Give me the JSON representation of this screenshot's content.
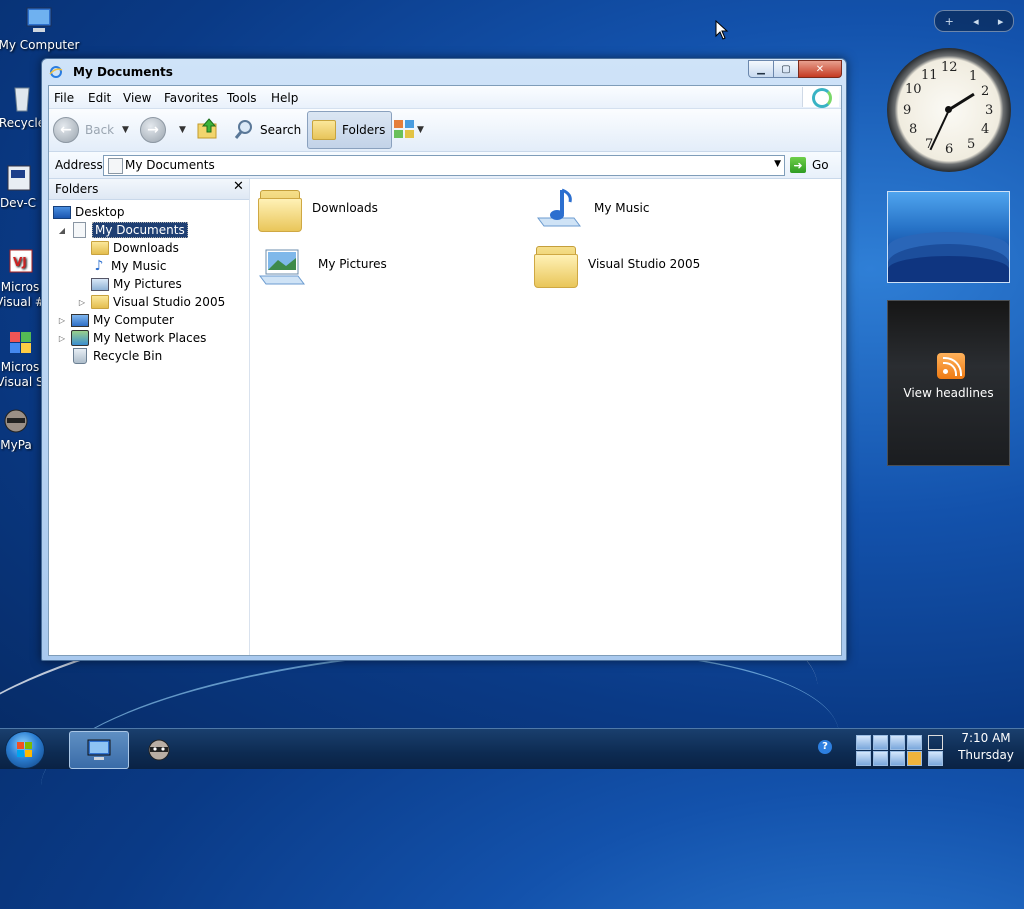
{
  "desktop": {
    "icons": [
      {
        "label": "My Computer"
      },
      {
        "label": "Recycle"
      },
      {
        "label": "Dev-C"
      },
      {
        "label": "Micros Visual #"
      },
      {
        "label": "Micros Visual S"
      },
      {
        "label": "MyPa"
      }
    ]
  },
  "window": {
    "title": "My Documents",
    "menu": [
      "File",
      "Edit",
      "View",
      "Favorites",
      "Tools",
      "Help"
    ],
    "toolbar": {
      "back_label": "Back",
      "search_label": "Search",
      "folders_label": "Folders"
    },
    "address": {
      "label": "Address",
      "value": "My Documents",
      "go_label": "Go"
    },
    "folders_pane": {
      "title": "Folders",
      "close_glyph": "✕",
      "tree": [
        {
          "label": "Desktop",
          "icon": "desktop-icon"
        },
        {
          "label": "My Documents",
          "icon": "documents-icon",
          "selected": true
        },
        {
          "label": "Downloads",
          "icon": "folder-icon"
        },
        {
          "label": "My Music",
          "icon": "music-icon"
        },
        {
          "label": "My Pictures",
          "icon": "pictures-icon"
        },
        {
          "label": "Visual Studio 2005",
          "icon": "folder-icon"
        },
        {
          "label": "My Computer",
          "icon": "computer-icon"
        },
        {
          "label": "My Network Places",
          "icon": "network-icon"
        },
        {
          "label": "Recycle Bin",
          "icon": "recycle-bin-icon"
        }
      ]
    },
    "content": {
      "items": [
        {
          "label": "Downloads",
          "icon": "folder-icon"
        },
        {
          "label": "My Music",
          "icon": "music-folder-icon"
        },
        {
          "label": "My Pictures",
          "icon": "pictures-folder-icon"
        },
        {
          "label": "Visual Studio 2005",
          "icon": "folder-icon"
        }
      ]
    }
  },
  "gadgets": {
    "clock_numbers": [
      "12",
      "1",
      "2",
      "3",
      "4",
      "5",
      "6",
      "7",
      "8",
      "9",
      "10",
      "11"
    ],
    "feed_label": "View headlines"
  },
  "taskbar": {
    "time": "7:10 AM",
    "day": "Thursday"
  },
  "colors": {
    "selection": "#1f3f73",
    "desktop": "#1352ac"
  }
}
